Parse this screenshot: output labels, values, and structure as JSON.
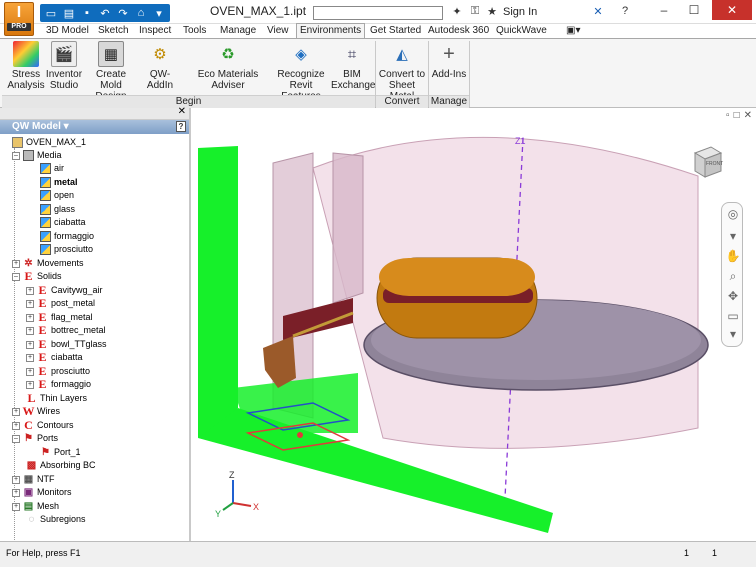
{
  "app": {
    "badge_letter": "I",
    "badge_label": "PRO"
  },
  "title": {
    "document": "OVEN_MAX_1.ipt",
    "sign_in": "Sign In"
  },
  "tabs": [
    {
      "label": "3D Model"
    },
    {
      "label": "Sketch"
    },
    {
      "label": "Inspect"
    },
    {
      "label": "Tools"
    },
    {
      "label": "Manage"
    },
    {
      "label": "View"
    },
    {
      "label": "Environments",
      "active": true
    },
    {
      "label": "Get Started"
    },
    {
      "label": "Autodesk 360"
    },
    {
      "label": "QuickWave"
    }
  ],
  "ribbon": {
    "buttons": [
      {
        "label1": "Stress",
        "label2": "Analysis",
        "icon": "stress-analysis-icon"
      },
      {
        "label1": "Inventor",
        "label2": "Studio",
        "icon": "inventor-studio-icon"
      },
      {
        "label1": "Create",
        "label2": "Mold Design",
        "icon": "mold-design-icon"
      },
      {
        "label1": "QW-AddIn",
        "label2": "",
        "icon": "qw-addin-icon"
      },
      {
        "label1": "Eco Materials Adviser",
        "label2": "",
        "icon": "eco-materials-icon"
      },
      {
        "label1": "Recognize",
        "label2": "Revit Features",
        "icon": "revit-features-icon"
      },
      {
        "label1": "BIM",
        "label2": "Exchange",
        "icon": "bim-exchange-icon"
      },
      {
        "label1": "Convert to",
        "label2": "Sheet Metal",
        "icon": "sheet-metal-icon"
      },
      {
        "label1": "Add-Ins",
        "label2": "",
        "icon": "add-ins-icon"
      }
    ],
    "panels": {
      "begin": "Begin",
      "convert": "Convert",
      "manage": "Manage"
    }
  },
  "browser": {
    "title": "QW Model",
    "help": "?",
    "tree": {
      "root": "OVEN_MAX_1",
      "media": "Media",
      "media_items": [
        "air",
        "metal",
        "open",
        "glass",
        "ciabatta",
        "formaggio",
        "prosciutto"
      ],
      "movements": "Movements",
      "solids": "Solids",
      "solids_items": [
        "Cavitywg_air",
        "post_metal",
        "flag_metal",
        "bottrec_metal",
        "bowl_TTglass",
        "ciabatta",
        "prosciutto",
        "formaggio"
      ],
      "thin_layers": "Thin Layers",
      "wires": "Wires",
      "contours": "Contours",
      "ports": "Ports",
      "port_1": "Port_1",
      "absorbing_bc": "Absorbing BC",
      "ntf": "NTF",
      "monitors": "Monitors",
      "mesh": "Mesh",
      "subregions": "Subregions"
    }
  },
  "viewport": {
    "viewcube_label": "FRONT",
    "axis_label": "Z1",
    "axes": {
      "z": "Z",
      "x": "X",
      "y": "Y"
    }
  },
  "status": {
    "help_text": "For Help, press F1",
    "count_1": "1",
    "count_2": "1"
  }
}
